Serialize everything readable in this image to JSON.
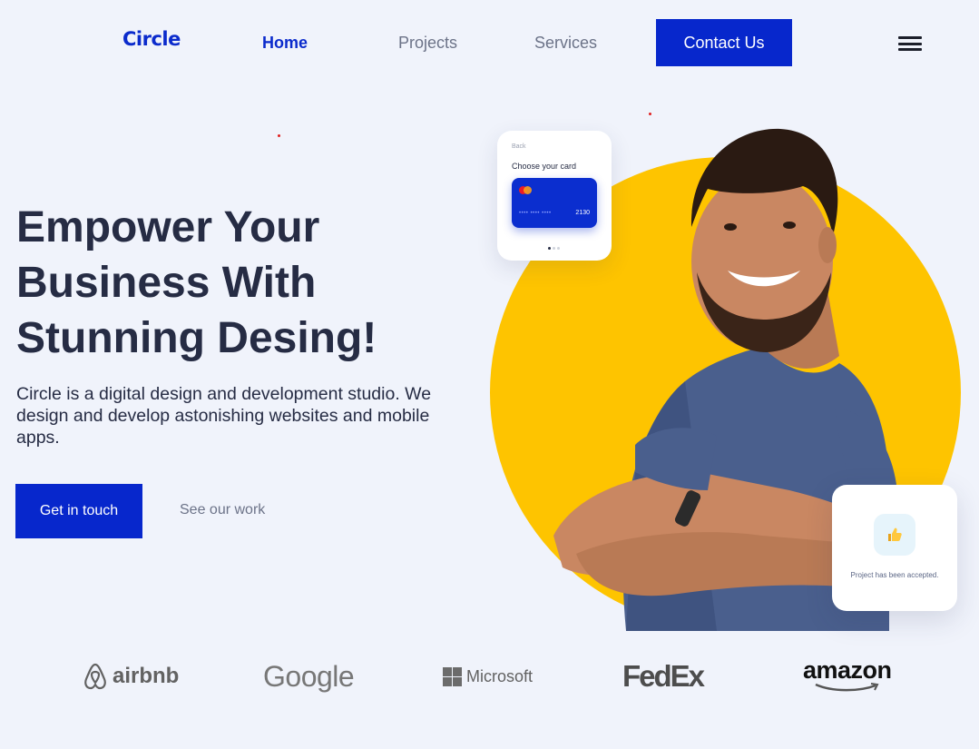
{
  "nav": {
    "logo": "Circle",
    "links": [
      "Home",
      "Projects",
      "Services"
    ],
    "active": "Home",
    "cta": "Contact Us"
  },
  "hero": {
    "title_lines": [
      "Empower Your",
      "Business With",
      "Stunning Desing!"
    ],
    "description": "Circle is a digital design and development studio. We design and develop astonishing websites and mobile apps.",
    "primary_button": "Get in touch",
    "secondary_button": "See our work"
  },
  "card_widget": {
    "back": "Back",
    "title": "Choose your card",
    "card_mask": "•••• •••• ••••",
    "card_last4": "2130"
  },
  "accept_widget": {
    "icon": "thumbs-up-icon",
    "text": "Project has been accepted."
  },
  "brands": [
    "airbnb",
    "Google",
    "Microsoft",
    "FedEx",
    "amazon"
  ],
  "colors": {
    "primary": "#0727cc",
    "accent_yellow": "#fec400",
    "background": "#f0f3fb",
    "heading": "#262c44",
    "muted": "#6c7388"
  }
}
